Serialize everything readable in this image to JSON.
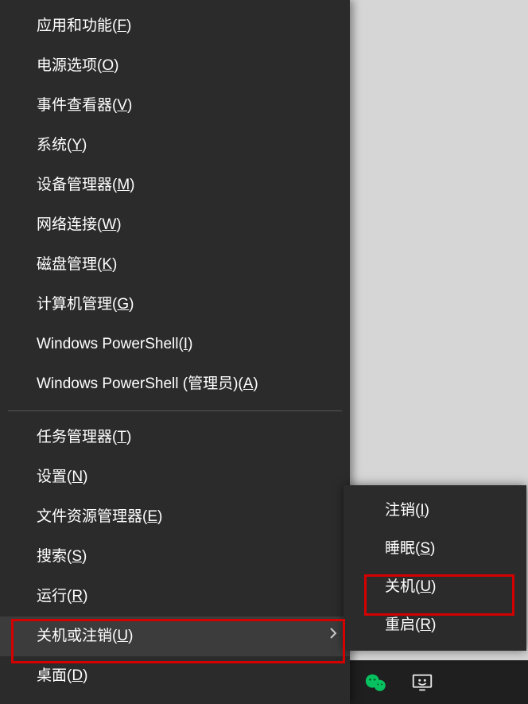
{
  "menu": {
    "group1": [
      {
        "text": "应用和功能",
        "accel": "F"
      },
      {
        "text": "电源选项",
        "accel": "O"
      },
      {
        "text": "事件查看器",
        "accel": "V"
      },
      {
        "text": "系统",
        "accel": "Y"
      },
      {
        "text": "设备管理器",
        "accel": "M"
      },
      {
        "text": "网络连接",
        "accel": "W"
      },
      {
        "text": "磁盘管理",
        "accel": "K"
      },
      {
        "text": "计算机管理",
        "accel": "G"
      },
      {
        "text": "Windows PowerShell",
        "accel": "I"
      },
      {
        "text": "Windows PowerShell (管理员)",
        "accel": "A"
      }
    ],
    "group2": [
      {
        "text": "任务管理器",
        "accel": "T"
      },
      {
        "text": "设置",
        "accel": "N"
      },
      {
        "text": "文件资源管理器",
        "accel": "E"
      },
      {
        "text": "搜索",
        "accel": "S"
      },
      {
        "text": "运行",
        "accel": "R"
      },
      {
        "text": "关机或注销",
        "accel": "U",
        "submenu": true,
        "hovered": true
      },
      {
        "text": "桌面",
        "accel": "D"
      }
    ]
  },
  "submenu": {
    "items": [
      {
        "text": "注销",
        "accel": "I"
      },
      {
        "text": "睡眠",
        "accel": "S"
      },
      {
        "text": "关机",
        "accel": "U",
        "highlight": true
      },
      {
        "text": "重启",
        "accel": "R"
      }
    ]
  },
  "taskbar": {
    "wechat": "wechat-icon",
    "display": "display-icon"
  }
}
